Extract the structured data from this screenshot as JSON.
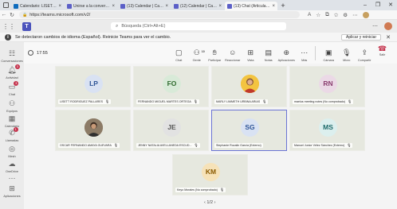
{
  "browser": {
    "tabs": [
      {
        "title": "Calendario: LISETT RODRÍGUEZ",
        "color": "#0f6cbd",
        "active": false
      },
      {
        "title": "Unirse a la conversación",
        "color": "#5b5fc7",
        "active": false
      },
      {
        "title": "(13) Calendar | Calendar | Mic",
        "color": "#5b5fc7",
        "active": false
      },
      {
        "title": "(12) Calendar | Calendar | Mic",
        "color": "#5b5fc7",
        "active": false
      },
      {
        "title": "(13) Chat (Articulación",
        "color": "#5b5fc7",
        "active": true
      }
    ],
    "url": "https://teams.microsoft.com/v2/"
  },
  "teams": {
    "search_placeholder": "Búsqueda (Ctrl+Alt+E)",
    "notice_text": "Se detectaron cambios de idioma (Español). Reinicie Teams para ver el cambio.",
    "notice_button": "Aplicar y reiniciar"
  },
  "rail": [
    {
      "label": "Conversaciones",
      "icon": "people-icon",
      "badge": ""
    },
    {
      "label": "Actividad",
      "icon": "bell-icon",
      "badge": "3"
    },
    {
      "label": "Chat",
      "icon": "chat-icon",
      "badge": "3"
    },
    {
      "label": "Equipos",
      "icon": "teams-icon",
      "badge": ""
    },
    {
      "label": "Calendario",
      "icon": "calendar-icon",
      "badge": ""
    },
    {
      "label": "Llamadas",
      "icon": "call-icon",
      "badge": "1"
    },
    {
      "label": "Mesh",
      "icon": "mesh-icon",
      "badge": ""
    },
    {
      "label": "OneDrive",
      "icon": "cloud-icon",
      "badge": ""
    },
    {
      "label": "",
      "icon": "more-icon",
      "badge": ""
    },
    {
      "label": "Aplicaciones",
      "icon": "apps-icon",
      "badge": ""
    }
  ],
  "meeting": {
    "elapsed": "17:55",
    "tools": [
      {
        "label": "Chat",
        "icon": "chat-icon",
        "badge": ""
      },
      {
        "label": "Gente",
        "icon": "people-icon",
        "badge": "10"
      },
      {
        "label": "Participar",
        "icon": "raise-hand-icon",
        "badge": ""
      },
      {
        "label": "Reaccionar",
        "icon": "emoji-icon",
        "badge": ""
      },
      {
        "label": "Vista",
        "icon": "view-icon",
        "badge": ""
      },
      {
        "label": "Notas",
        "icon": "notes-icon",
        "badge": ""
      },
      {
        "label": "Aplicaciones",
        "icon": "add-apps-icon",
        "badge": ""
      },
      {
        "label": "Más",
        "icon": "more-icon",
        "badge": ""
      }
    ],
    "devices": [
      {
        "label": "Cámara",
        "icon": "camera-off-icon"
      },
      {
        "label": "Micro",
        "icon": "mic-icon"
      },
      {
        "label": "Compartir",
        "icon": "share-icon"
      }
    ],
    "leave_label": "Salir",
    "pager": "1/2"
  },
  "participants": [
    {
      "initials": "LP",
      "name": "LISETT RODRIGUEZ PALLARES",
      "bg": "#d9e2f3",
      "fg": "#2f5597",
      "photo": false
    },
    {
      "initials": "FO",
      "name": "FERNANDO MIGUEL MARTES ORTEGA",
      "bg": "#d8ead8",
      "fg": "#2e6b2e",
      "photo": false
    },
    {
      "initials": "MU",
      "name": "MARLY LIMMETH URBINA ARIAS",
      "bg": "#f0c040",
      "fg": "#6b3b00",
      "photo": true
    },
    {
      "initials": "RN",
      "name": "maelus meeting notes (No comprobado)",
      "bg": "#ebd9e6",
      "fg": "#8a3e6f",
      "photo": false
    },
    {
      "initials": "OA",
      "name": "OSCAR FERNANDO AMAYA GUEVARA",
      "bg": "#7b6a55",
      "fg": "#ffffff",
      "photo": true
    },
    {
      "initials": "JE",
      "name": "JENNY NATALIA AVELLANEDA ESCUD...",
      "bg": "#e2e2e2",
      "fg": "#555555",
      "photo": false
    },
    {
      "initials": "SG",
      "name": "Stephanie Rozalin García (Externo)",
      "bg": "#d9e2f3",
      "fg": "#2f5597",
      "photo": false
    },
    {
      "initials": "MS",
      "name": "Manuel Junior Vélez Sánchez (Externo)",
      "bg": "#dcefee",
      "fg": "#1e6a6a",
      "photo": false
    },
    {
      "initials": "KM",
      "name": "Keyo Morales (No comprobado)",
      "bg": "#f6e2b8",
      "fg": "#8a5a00",
      "photo": false
    }
  ]
}
